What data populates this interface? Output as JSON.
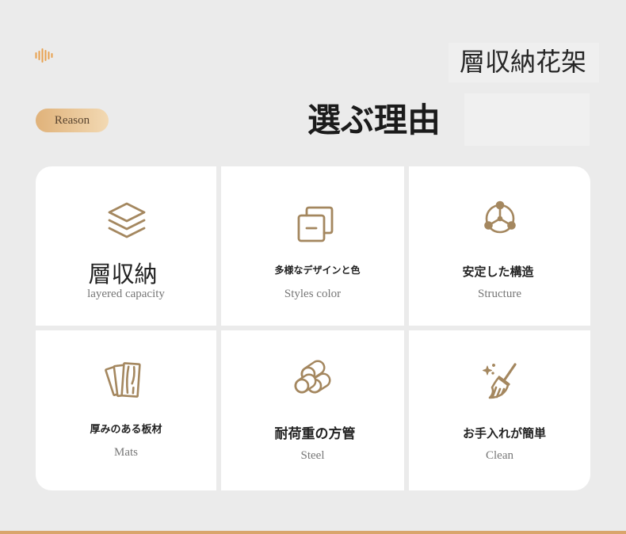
{
  "header": {
    "title": "層収納花架",
    "badge": "Reason",
    "heading": "選ぶ理由",
    "wave_icon": "sound-wave-icon"
  },
  "features": [
    {
      "icon": "layers-icon",
      "title": "層収納",
      "subtitle": "layered capacity"
    },
    {
      "icon": "overlap-squares-icon",
      "title": "多様なデザインと色",
      "subtitle": "Styles color"
    },
    {
      "icon": "structure-nodes-icon",
      "title": "安定した構造",
      "subtitle": "Structure"
    },
    {
      "icon": "wood-boards-icon",
      "title": "厚みのある板材",
      "subtitle": "Mats"
    },
    {
      "icon": "steel-pipes-icon",
      "title": "耐荷重の方管",
      "subtitle": "Steel"
    },
    {
      "icon": "broom-icon",
      "title": "お手入れが簡単",
      "subtitle": "Clean"
    }
  ],
  "colors": {
    "accent": "#a4875f",
    "background": "#ebebeb",
    "bottom_line": "#d9a56c",
    "wave": "#e8a04e",
    "badge_from": "#e0b27a",
    "badge_to": "#f2d9b3"
  }
}
